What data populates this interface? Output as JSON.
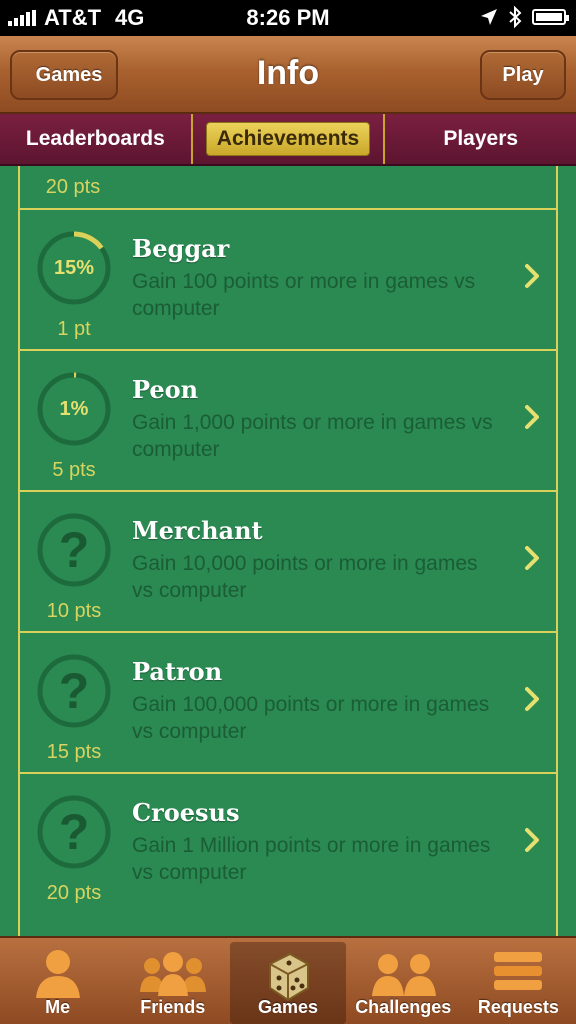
{
  "status": {
    "carrier": "AT&T",
    "network": "4G",
    "time": "8:26 PM"
  },
  "nav": {
    "back_label": "Games",
    "title": "Info",
    "play_label": "Play"
  },
  "tabs": [
    {
      "label": "Leaderboards",
      "active": false
    },
    {
      "label": "Achievements",
      "active": true
    },
    {
      "label": "Players",
      "active": false
    }
  ],
  "top_points": "20 pts",
  "achievements": [
    {
      "title": "Beggar",
      "desc": "Gain 100 points or more in games vs computer",
      "points": "1 pt",
      "progress": "15%",
      "unlocked_progress": 0.15,
      "icon": "progress-ring"
    },
    {
      "title": "Peon",
      "desc": "Gain 1,000 points or more in games vs computer",
      "points": "5 pts",
      "progress": "1%",
      "unlocked_progress": 0.01,
      "icon": "progress-ring"
    },
    {
      "title": "Merchant",
      "desc": "Gain 10,000 points or more in games vs computer",
      "points": "10 pts",
      "icon": "question-mark-icon"
    },
    {
      "title": "Patron",
      "desc": "Gain 100,000 points or more in games vs computer",
      "points": "15 pts",
      "icon": "question-mark-icon"
    },
    {
      "title": "Croesus",
      "desc": "Gain 1 Million points or more in games vs computer",
      "points": "20 pts",
      "icon": "question-mark-icon"
    }
  ],
  "tabbar": [
    {
      "label": "Me",
      "icon": "person-icon",
      "active": false
    },
    {
      "label": "Friends",
      "icon": "friends-icon",
      "active": false
    },
    {
      "label": "Games",
      "icon": "dice-icon",
      "active": true
    },
    {
      "label": "Challenges",
      "icon": "challenges-icon",
      "active": false
    },
    {
      "label": "Requests",
      "icon": "requests-icon",
      "active": false
    }
  ],
  "colors": {
    "felt": "#2a8a52",
    "gold": "#d9d15a",
    "wood": "#a9622f",
    "tab_maroon": "#6a1a37"
  }
}
